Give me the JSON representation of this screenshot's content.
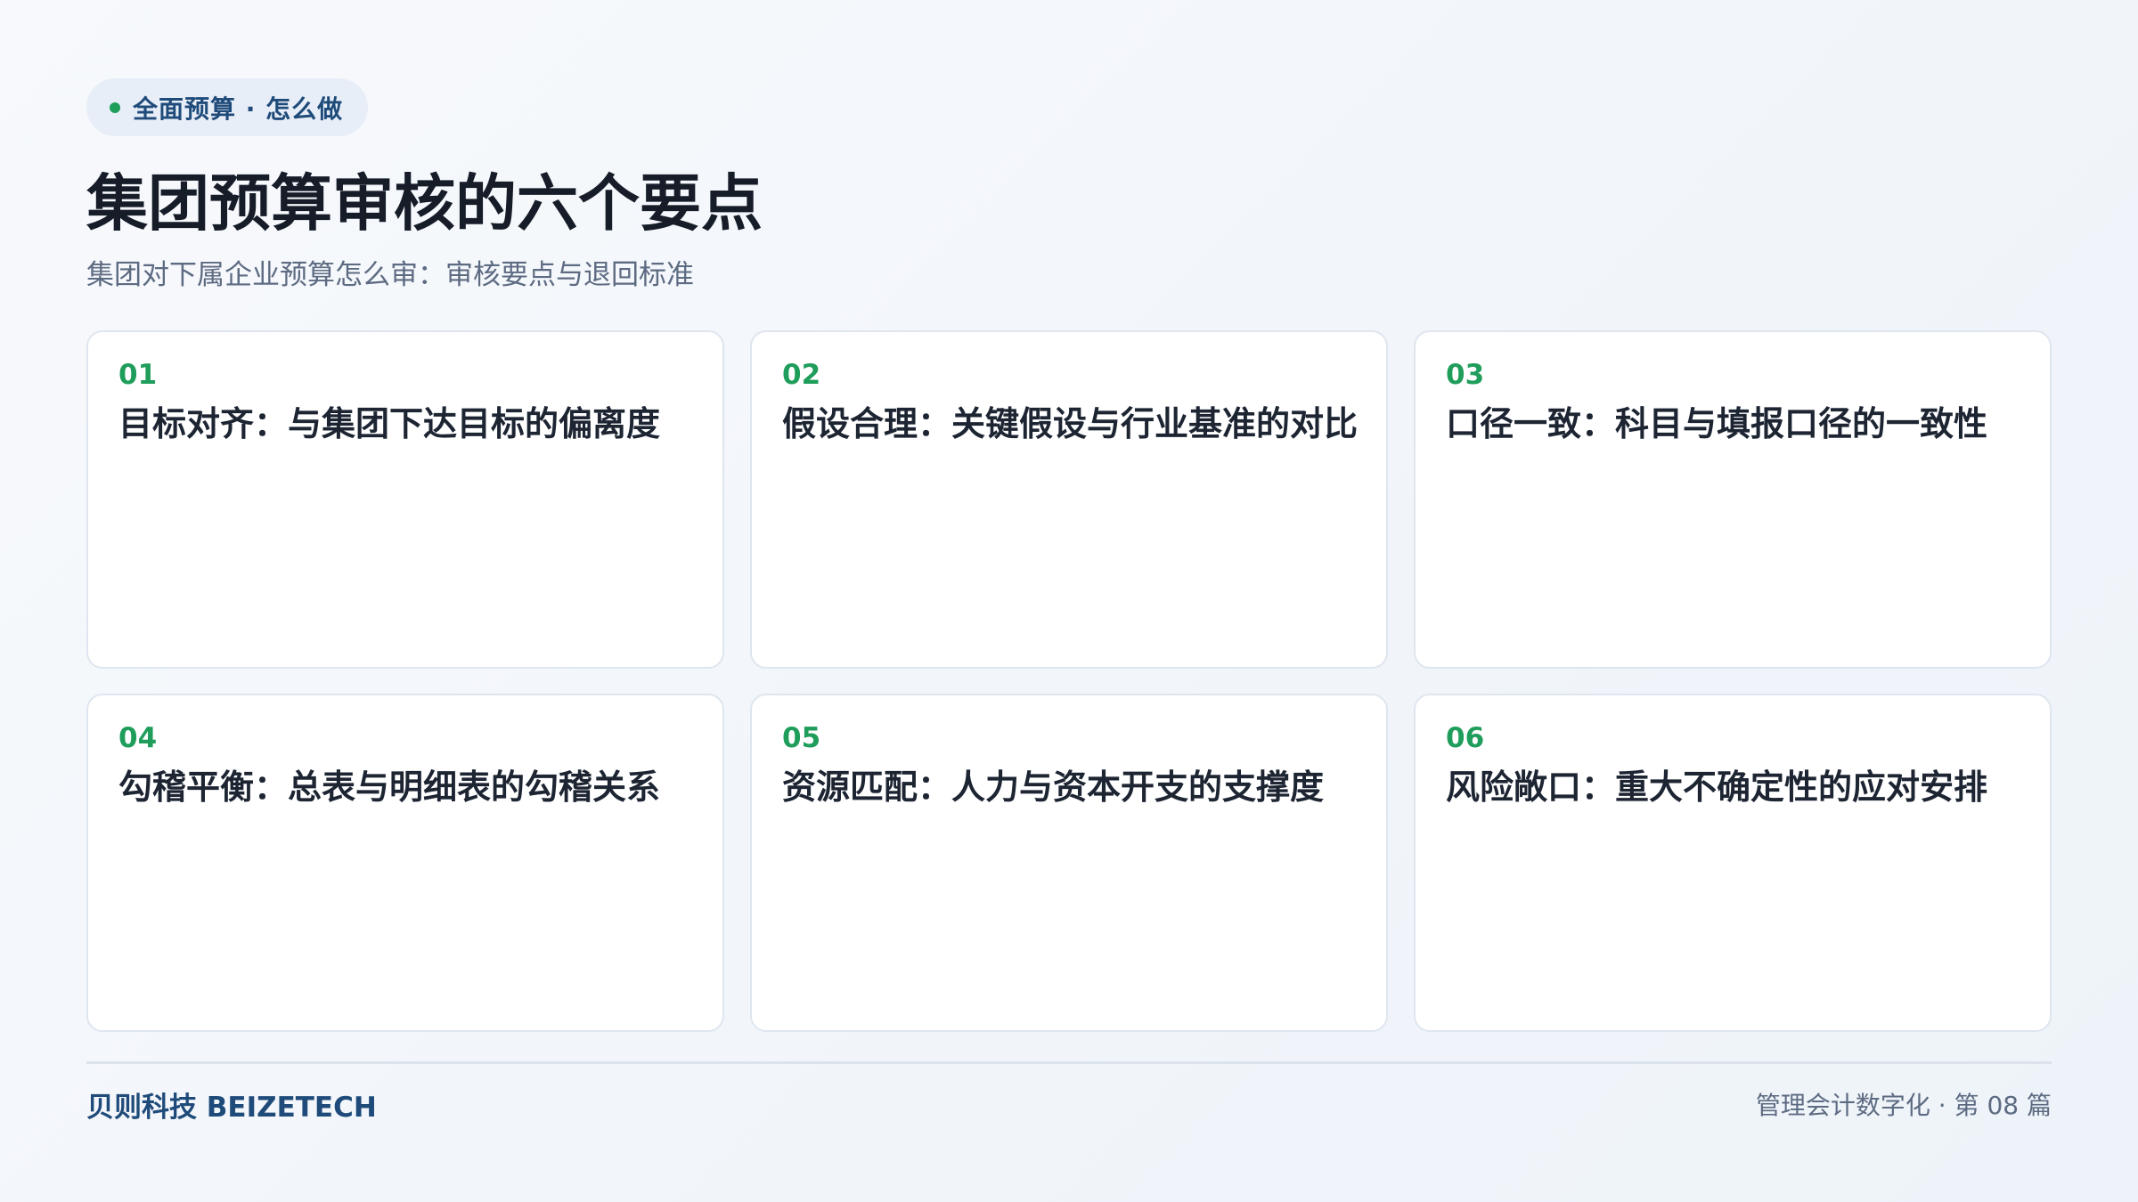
{
  "tag": {
    "label": "全面预算 · 怎么做"
  },
  "header": {
    "title": "集团预算审核的六个要点",
    "subtitle": "集团对下属企业预算怎么审：审核要点与退回标准"
  },
  "cards": [
    {
      "num": "01",
      "title": "目标对齐：与集团下达目标的偏离度"
    },
    {
      "num": "02",
      "title": "假设合理：关键假设与行业基准的对比"
    },
    {
      "num": "03",
      "title": "口径一致：科目与填报口径的一致性"
    },
    {
      "num": "04",
      "title": "勾稽平衡：总表与明细表的勾稽关系"
    },
    {
      "num": "05",
      "title": "资源匹配：人力与资本开支的支撑度"
    },
    {
      "num": "06",
      "title": "风险敞口：重大不确定性的应对安排"
    }
  ],
  "footer": {
    "brand": "贝则科技 BEIZETECH",
    "series": "管理会计数字化 · 第 08 篇"
  },
  "colors": {
    "accent_green": "#1f9d5b",
    "brand_blue": "#1f4b7a",
    "title_dark": "#161d29",
    "muted_gray": "#5d6b82"
  }
}
